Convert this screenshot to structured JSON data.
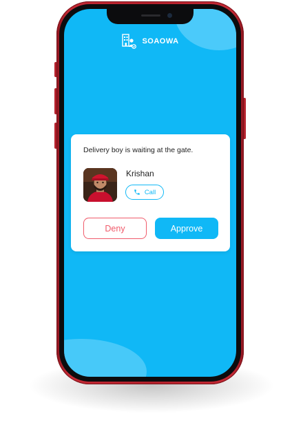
{
  "app": {
    "brand_name": "SOAOWA"
  },
  "notification": {
    "message": "Delivery boy is waiting at the gate.",
    "visitor_name": "Krishan",
    "call_label": "Call",
    "deny_label": "Deny",
    "approve_label": "Approve"
  },
  "icons": {
    "brand": "building-person-icon",
    "call": "phone-icon",
    "avatar": "delivery-person-photo"
  },
  "colors": {
    "accent": "#10b8f6",
    "deny": "#f05a6a",
    "phone_frame": "#b3222c"
  }
}
